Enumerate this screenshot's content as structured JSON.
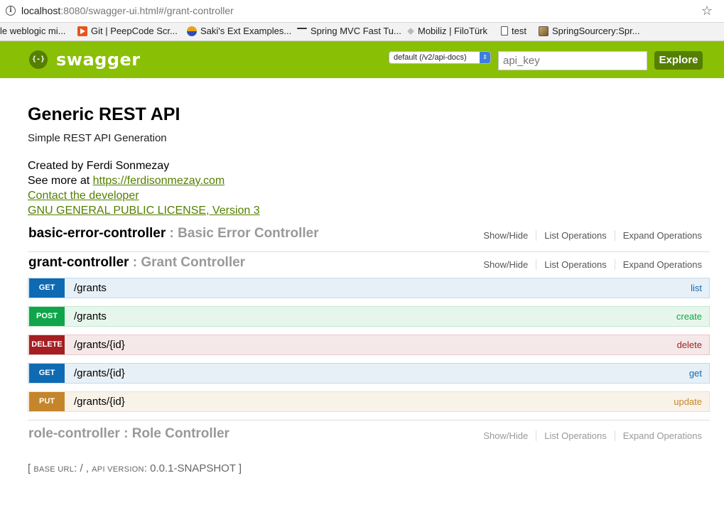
{
  "browser": {
    "url_host": "localhost",
    "url_rest": ":8080/swagger-ui.html#/grant-controller",
    "bookmarks": [
      "le weblogic mi...",
      "Git | PeepCode Scr...",
      "Saki's Ext Examples...",
      "Spring MVC Fast Tu...",
      "Mobiliz | FiloTürk",
      "test",
      "SpringSourcery:Spr..."
    ]
  },
  "header": {
    "logo_mark": "{-}",
    "logo_text": "swagger",
    "spec_selected": "default (/v2/api-docs)",
    "api_key_placeholder": "api_key",
    "explore_label": "Explore",
    "colors": {
      "bar": "#89bf04",
      "accent": "#547f00"
    }
  },
  "info": {
    "title": "Generic REST API",
    "description": "Simple REST API Generation",
    "created_by": "Created by Ferdi Sonmezay",
    "see_more_prefix": "See more at ",
    "see_more_link": "https://ferdisonmezay.com",
    "contact": "Contact the developer",
    "license": "GNU GENERAL PUBLIC LICENSE, Version 3"
  },
  "controllers": [
    {
      "name": "basic-error-controller",
      "sep": " : ",
      "description": "Basic Error Controller",
      "ops": [
        "Show/Hide",
        "List Operations",
        "Expand Operations"
      ]
    },
    {
      "name": "grant-controller",
      "sep": " : ",
      "description": "Grant Controller",
      "ops": [
        "Show/Hide",
        "List Operations",
        "Expand Operations"
      ],
      "endpoints": [
        {
          "method": "GET",
          "path": "/grants",
          "action": "list",
          "color": "#0f6ab4"
        },
        {
          "method": "POST",
          "path": "/grants",
          "action": "create",
          "color": "#10a54a"
        },
        {
          "method": "DELETE",
          "path": "/grants/{id}",
          "action": "delete",
          "color": "#a41e22"
        },
        {
          "method": "GET",
          "path": "/grants/{id}",
          "action": "get",
          "color": "#0f6ab4"
        },
        {
          "method": "PUT",
          "path": "/grants/{id}",
          "action": "update",
          "color": "#c5862b"
        }
      ]
    },
    {
      "name": "role-controller",
      "sep": " : ",
      "description": "Role Controller",
      "ops": [
        "Show/Hide",
        "List Operations",
        "Expand Operations"
      ]
    }
  ],
  "footer": {
    "open": "[ ",
    "base_url_label": "BASE URL",
    "base_url_value": ": / , ",
    "api_version_label": "API VERSION",
    "api_version_value": ": 0.0.1-SNAPSHOT ]"
  }
}
